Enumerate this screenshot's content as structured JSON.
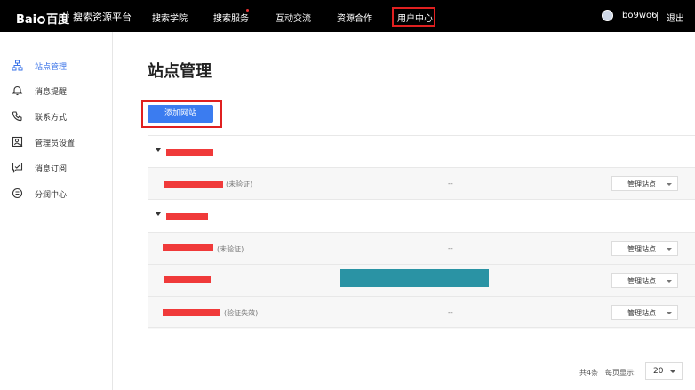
{
  "header": {
    "logo_text_left": "Bai",
    "logo_text_right": "百度",
    "platform_name": "搜索资源平台",
    "nav": [
      {
        "label": "搜索学院"
      },
      {
        "label": "搜索服务"
      },
      {
        "label": "互动交流"
      },
      {
        "label": "资源合作"
      },
      {
        "label": "用户中心"
      }
    ],
    "username": "bo9wo6",
    "logout": "退出"
  },
  "sidebar": {
    "items": [
      {
        "label": "站点管理",
        "icon": "sitemap-icon",
        "active": true
      },
      {
        "label": "消息提醒",
        "icon": "bell-icon"
      },
      {
        "label": "联系方式",
        "icon": "phone-icon"
      },
      {
        "label": "管理员设置",
        "icon": "admin-icon"
      },
      {
        "label": "消息订阅",
        "icon": "subscribe-icon"
      },
      {
        "label": "分润中心",
        "icon": "revenue-icon"
      }
    ]
  },
  "main": {
    "title": "站点管理",
    "add_site_button": "添加网站",
    "groups": [
      {
        "sites": [
          {
            "status": "(未验证)",
            "metric": "--",
            "manage": "管理站点"
          }
        ]
      },
      {
        "sites": [
          {
            "status": "(未验证)",
            "metric": "--",
            "manage": "管理站点"
          },
          {
            "status": "",
            "metric": "",
            "manage": "管理站点"
          },
          {
            "status": "(验证失效)",
            "metric": "--",
            "manage": "管理站点"
          }
        ]
      }
    ],
    "pagination": {
      "total": "共4条",
      "page_size_label": "每页显示:",
      "page_size": "20"
    }
  },
  "colors": {
    "accent": "#3b7cf0",
    "highlight_border": "#e02020",
    "redaction": "#f03a3a",
    "teal_block": "#2a93a4"
  }
}
